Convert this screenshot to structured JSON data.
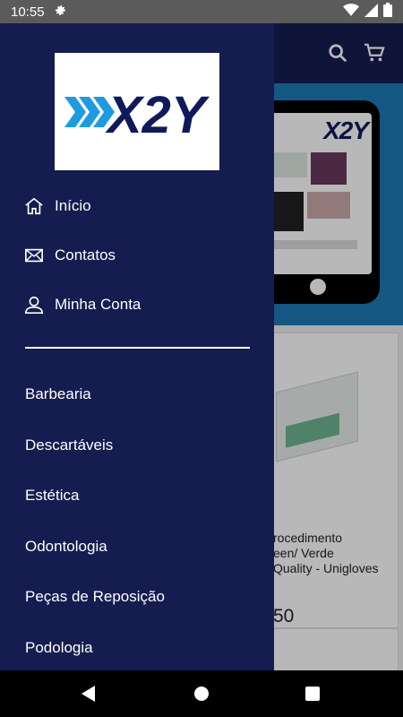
{
  "status_bar": {
    "time": "10:55",
    "icons": [
      "gear-icon",
      "wifi-icon",
      "signal-icon",
      "battery-icon"
    ]
  },
  "app": {
    "header_icons": [
      "search-icon",
      "cart-icon"
    ],
    "banner_logo": "X2Y",
    "product": {
      "name_lines": [
        "rocedimento",
        "een/ Verde",
        "Quality - Unigloves"
      ],
      "price": "50"
    }
  },
  "drawer": {
    "logo_text": "X2Y",
    "menu": [
      {
        "label": "Início",
        "icon": "home-icon"
      },
      {
        "label": "Contatos",
        "icon": "mail-icon"
      },
      {
        "label": "Minha Conta",
        "icon": "person-icon"
      }
    ],
    "categories": [
      "Barbearia",
      "Descartáveis",
      "Estética",
      "Odontologia",
      "Peças de Reposição",
      "Podologia"
    ]
  },
  "nav": {
    "buttons": [
      "back-button",
      "home-button",
      "recents-button"
    ]
  },
  "colors": {
    "drawer_bg": "#151c4f",
    "banner_bg": "#1e78b6",
    "logo_blue": "#101a5a",
    "chevron_blue": "#1e9be0"
  }
}
